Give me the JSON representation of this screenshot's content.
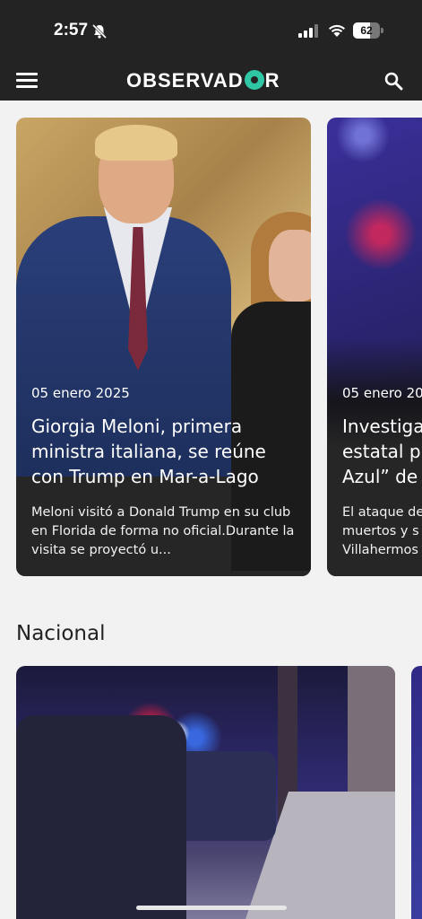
{
  "status_bar": {
    "time": "2:57",
    "battery": "62",
    "battery_level": 0.62,
    "icons": [
      "bell-slash-icon",
      "cellular-signal-icon",
      "wifi-icon",
      "battery-icon"
    ]
  },
  "header": {
    "logo_text": "OBSERVAD",
    "logo_text_end": "R",
    "logo_accent": "#2fc6a3",
    "background": "#232323",
    "icons": [
      "hamburger-menu-icon",
      "search-icon"
    ]
  },
  "featured": [
    {
      "date": "05 enero 2025",
      "title": "Giorgia Meloni, primera ministra italiana, se reúne con Trump en Mar-a-Lago",
      "summary": "Meloni visitó a Donald Trump en su club en Florida de forma no oficial.Durante la visita se proyectó u..."
    },
    {
      "date": "05 enero 20",
      "title_lines": [
        "Investiga",
        "estatal p",
        "Azul” de T"
      ],
      "summary_lines": [
        "El ataque de",
        "muertos y s",
        "Villahermos"
      ]
    }
  ],
  "sections": {
    "nacional": "Nacional"
  }
}
